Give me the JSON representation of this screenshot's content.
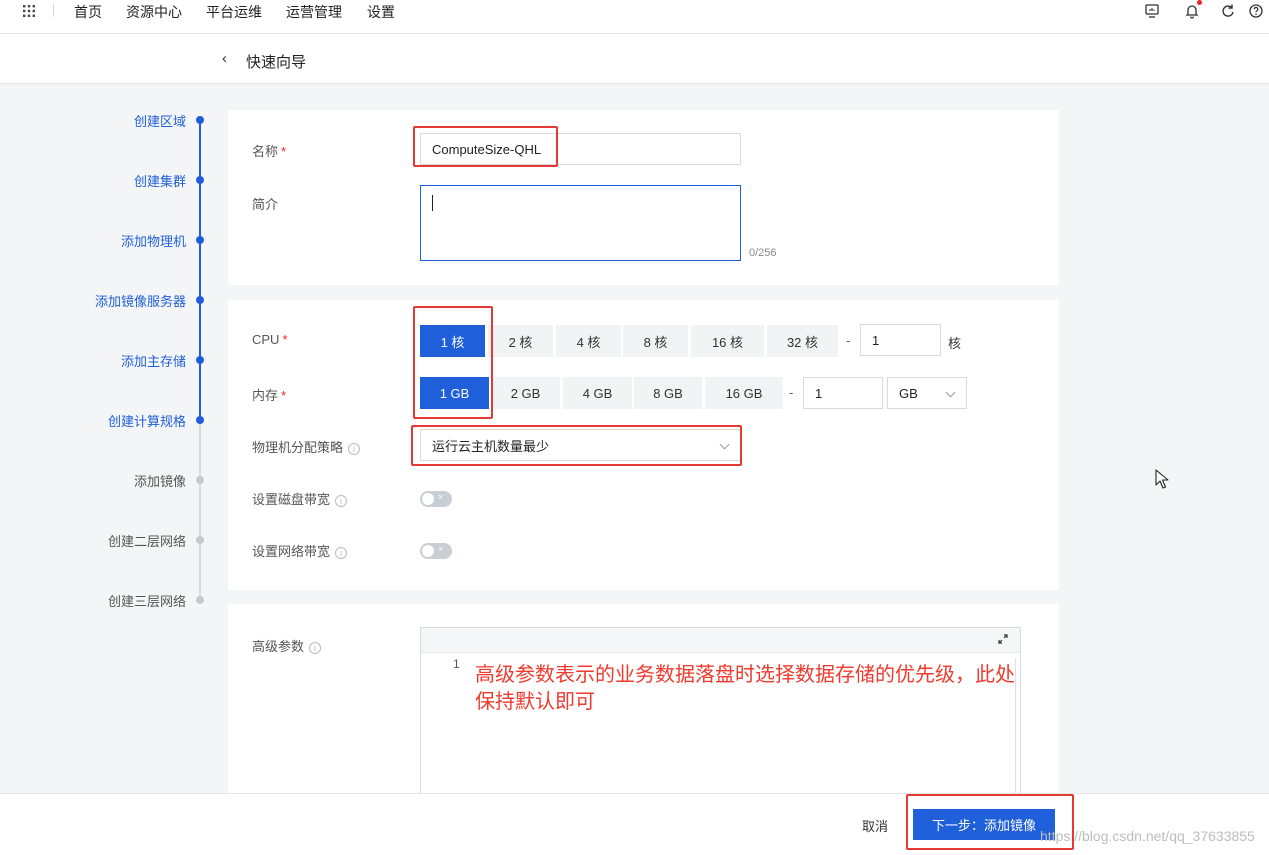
{
  "topnav": {
    "items": [
      "首页",
      "资源中心",
      "平台运维",
      "运营管理",
      "设置"
    ]
  },
  "header": {
    "title": "快速向导"
  },
  "steps": [
    {
      "label": "创建区域",
      "status": "done"
    },
    {
      "label": "创建集群",
      "status": "done"
    },
    {
      "label": "添加物理机",
      "status": "done"
    },
    {
      "label": "添加镜像服务器",
      "status": "done"
    },
    {
      "label": "添加主存储",
      "status": "done"
    },
    {
      "label": "创建计算规格",
      "status": "current"
    },
    {
      "label": "添加镜像",
      "status": "todo"
    },
    {
      "label": "创建二层网络",
      "status": "todo"
    },
    {
      "label": "创建三层网络",
      "status": "todo"
    }
  ],
  "form": {
    "name_label": "名称",
    "name_value": "ComputeSize-QHL",
    "desc_label": "简介",
    "desc_counter": "0/256",
    "cpu_label": "CPU",
    "cpu_options": [
      "1 核",
      "2 核",
      "4 核",
      "8 核",
      "16 核",
      "32 核"
    ],
    "cpu_dash": "-",
    "cpu_custom_value": "1",
    "cpu_unit": "核",
    "mem_label": "内存",
    "mem_options": [
      "1 GB",
      "2 GB",
      "4 GB",
      "8 GB",
      "16 GB"
    ],
    "mem_dash": "-",
    "mem_custom_value": "1",
    "mem_unit": "GB",
    "alloc_label": "物理机分配策略",
    "alloc_value": "运行云主机数量最少",
    "disk_bw_label": "设置磁盘带宽",
    "net_bw_label": "设置网络带宽",
    "advanced_label": "高级参数",
    "editor_line": "1",
    "required_mark": "*",
    "info_glyph": "i",
    "toggle_off_glyph": "×"
  },
  "annotation": "高级参数表示的业务数据落盘时选择数据存储的优先级，此处保持默认即可",
  "footer": {
    "cancel_label": "取消",
    "next_label": "下一步：添加镜像",
    "watermark": "https://blog.csdn.net/qq_37633855"
  },
  "colors": {
    "primary": "#1f5fd9",
    "annotation": "#e53935"
  }
}
